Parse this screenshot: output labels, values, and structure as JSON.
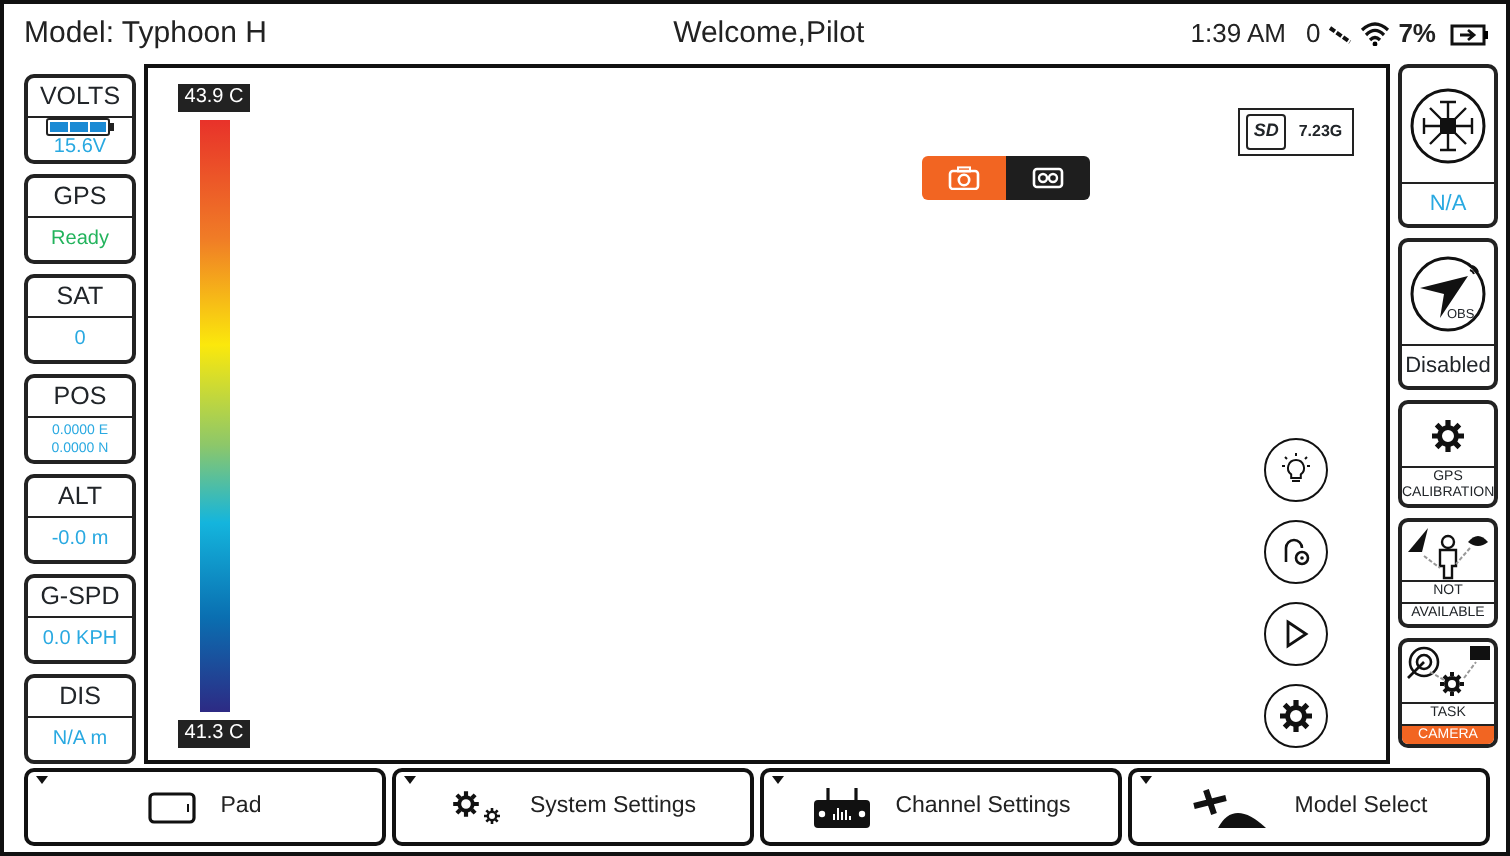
{
  "header": {
    "model": "Model: Typhoon H",
    "welcome": "Welcome,Pilot",
    "time": "1:39 AM",
    "satellites": "0",
    "battery": "7%"
  },
  "left_tiles": [
    {
      "kind": "battery",
      "label": "VOLTS",
      "values": [
        "15.6V"
      ],
      "color": "#29a9e1"
    },
    {
      "kind": "text",
      "label": "GPS",
      "values": [
        "Ready"
      ],
      "color": "#22b35c"
    },
    {
      "kind": "text",
      "label": "SAT",
      "values": [
        "0"
      ],
      "color": "#29a9e1"
    },
    {
      "kind": "small",
      "label": "POS",
      "values": [
        "0.0000 E",
        "0.0000 N"
      ],
      "color": "#29a9e1"
    },
    {
      "kind": "text",
      "label": "ALT",
      "values": [
        "-0.0 m"
      ],
      "color": "#29a9e1"
    },
    {
      "kind": "text",
      "label": "G-SPD",
      "values": [
        "0.0 KPH"
      ],
      "color": "#29a9e1"
    },
    {
      "kind": "text",
      "label": "DIS",
      "values": [
        "N/A m"
      ],
      "color": "#29a9e1"
    }
  ],
  "thermal": {
    "max": "43.9 C",
    "min": "41.3 C"
  },
  "capture_modes": [
    {
      "kind": "photo",
      "selected": true
    },
    {
      "kind": "video",
      "selected": false
    }
  ],
  "storage": {
    "label": "SD",
    "free": "7.23G"
  },
  "tool_buttons": [
    {
      "kind": "light"
    },
    {
      "kind": "lock"
    },
    {
      "kind": "play"
    },
    {
      "kind": "gear"
    }
  ],
  "right_tiles": [
    {
      "kind": "drone",
      "lines": [
        {
          "text": "N/A",
          "highlight": false
        }
      ]
    },
    {
      "kind": "obs",
      "icon_text": "OBS.",
      "lines": [
        {
          "text": "Disabled",
          "highlight": false
        }
      ]
    },
    {
      "kind": "gps",
      "lines": [
        {
          "text": "GPS CALIBRATION",
          "highlight": false
        }
      ]
    },
    {
      "kind": "follow",
      "lines": [
        {
          "text": "NOT",
          "highlight": false
        },
        {
          "text": "AVAILABLE",
          "highlight": false
        }
      ]
    },
    {
      "kind": "task",
      "lines": [
        {
          "text": "TASK",
          "highlight": false
        },
        {
          "text": "CAMERA",
          "highlight": true
        }
      ]
    }
  ],
  "bottom_tabs": [
    {
      "kind": "pad",
      "label": "Pad"
    },
    {
      "kind": "settings",
      "label": "System Settings"
    },
    {
      "kind": "remote",
      "label": "Channel Settings"
    },
    {
      "kind": "model",
      "label": "Model Select"
    }
  ]
}
